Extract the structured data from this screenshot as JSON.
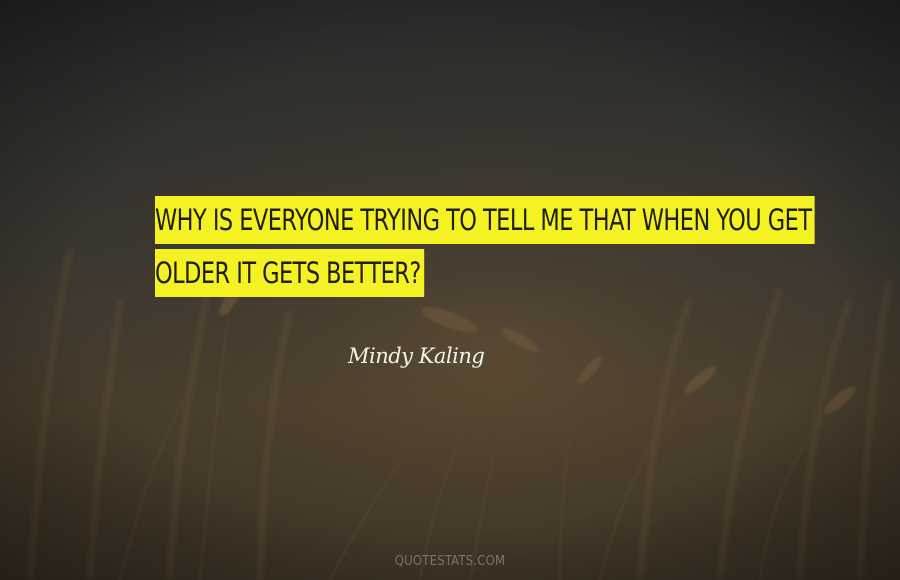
{
  "quote": {
    "lines": [
      "WHY IS EVERYONE TRYING TO TELL ME THAT WHEN YOU GET",
      "OLDER IT GETS BETTER?"
    ],
    "highlight_color": "#f4f222",
    "text_color": "#1f1f16"
  },
  "author": {
    "name": "Mindy Kaling",
    "color": "#f3f1e8"
  },
  "watermark": {
    "text": "QUOTESTATS.COM"
  },
  "background": {
    "scene": "wheat-field-at-dusk",
    "sky_color": "#2a2a29",
    "field_color": "#4a3c26"
  }
}
